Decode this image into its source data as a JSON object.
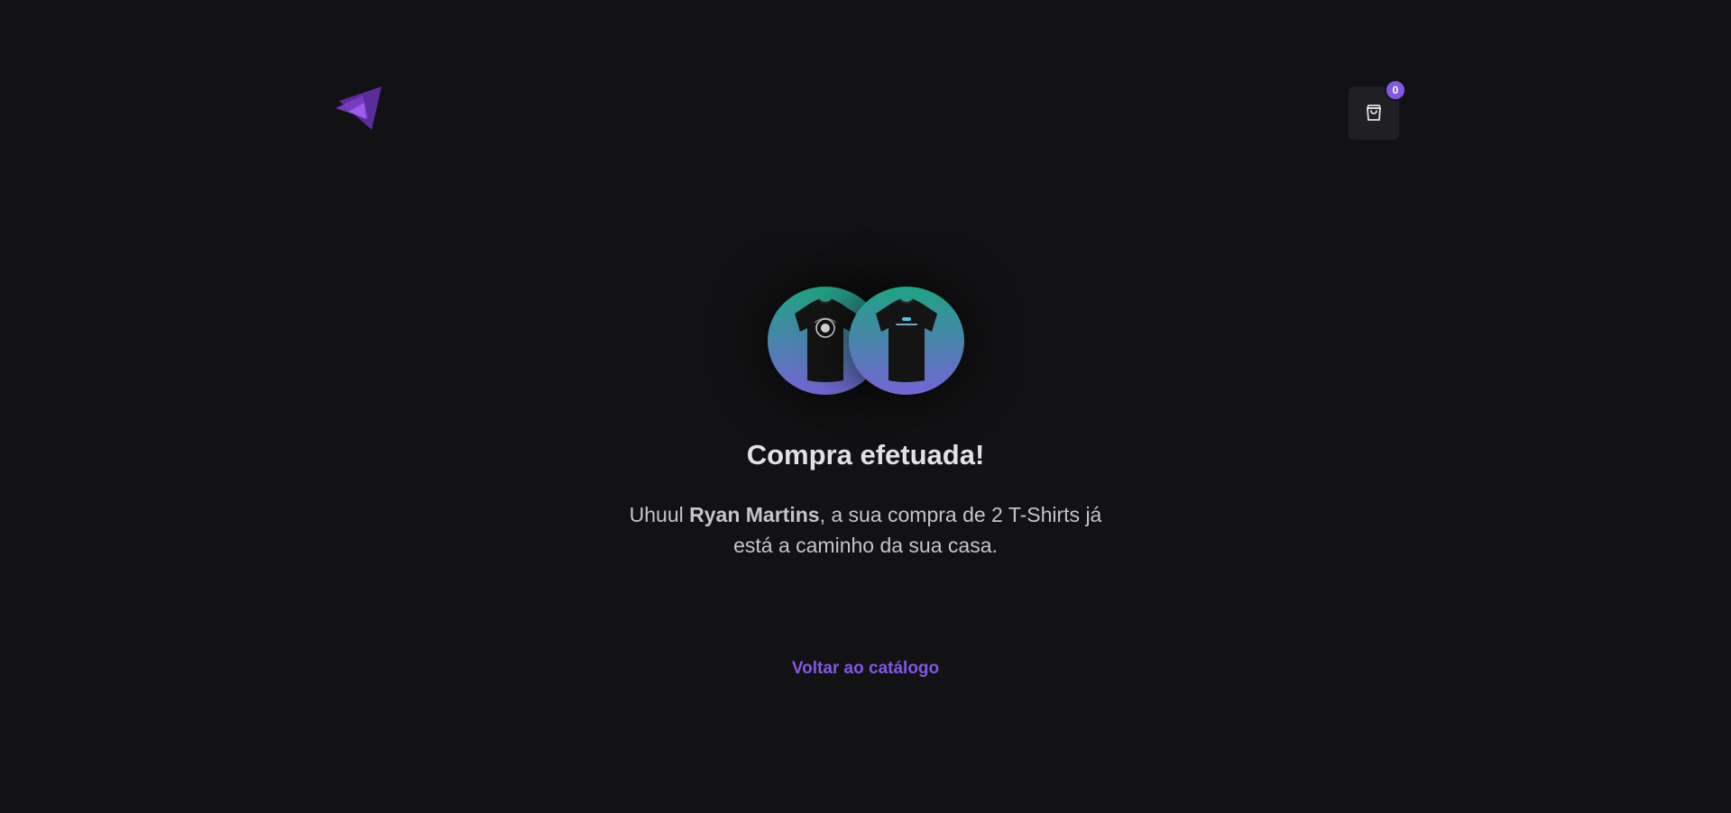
{
  "header": {
    "logo": "ignite-shop-logo",
    "cart": {
      "icon": "shopping-bag-icon",
      "count": "0"
    }
  },
  "colors": {
    "background": "#121214",
    "accent": "#8257e5",
    "cart_button": "#202024",
    "circle_gradient_top": "#1ea483",
    "circle_gradient_bottom": "#7465d4"
  },
  "success": {
    "products": [
      {
        "icon": "tshirt-icon"
      },
      {
        "icon": "tshirt-icon"
      }
    ],
    "title": "Compra efetuada!",
    "message_prefix": "Uhuul ",
    "customer_name": "Ryan Martins",
    "message_suffix": ", a sua compra de 2 T-Shirts já está a caminho da sua casa.",
    "back_link": "Voltar ao catálogo"
  }
}
